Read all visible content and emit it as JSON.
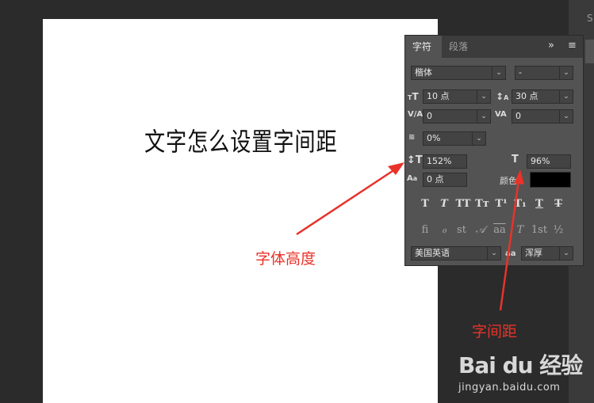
{
  "document": {
    "text": "文字怎么设置字间距"
  },
  "annotations": {
    "height_label": "字体高度",
    "spacing_label": "字间距"
  },
  "panel": {
    "tabs": [
      "字符",
      "段落"
    ],
    "expand_icon": "»",
    "menu_icon": "≡",
    "font_family": "楷体",
    "font_style": "-",
    "font_size": "10 点",
    "leading": "30 点",
    "kerning": "0",
    "tracking": "0",
    "tsume": "0%",
    "vertical_scale": "152%",
    "horizontal_scale": "96%",
    "baseline_shift": "0 点",
    "color_label": "颜色：",
    "color_value": "#000000",
    "language": "美国英语",
    "antialias_icon": "aa",
    "antialias": "浑厚",
    "style_buttons": [
      "T",
      "T",
      "TT",
      "Tт",
      "T¹",
      "T₁",
      "T",
      "T"
    ],
    "opentype_buttons": [
      "fi",
      "ℴ",
      "st",
      "𝒜",
      "aa",
      "T",
      "1st",
      "½"
    ]
  },
  "watermark": {
    "logo": "Bai du 经验",
    "url": "jingyan.baidu.com"
  },
  "colors": {
    "annotation": "#e8332a",
    "panel_bg": "#535353",
    "workspace": "#2b2b2b"
  }
}
